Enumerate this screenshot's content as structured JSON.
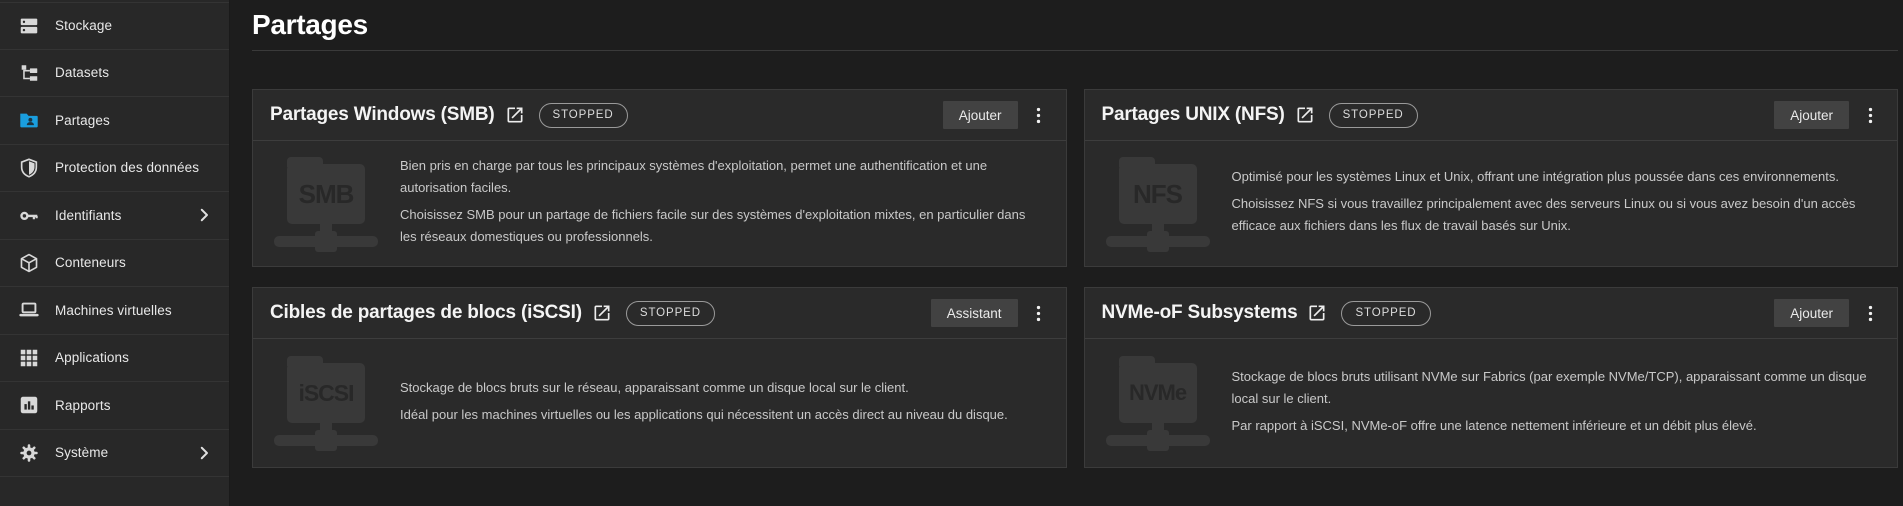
{
  "colors": {
    "accent_blue": "#1a9ede",
    "sidebar_bg": "#282828",
    "main_bg": "#1d1d1d",
    "card_bg": "#2a2a2a",
    "button_bg": "#424242",
    "badge_border": "#9a9a9a"
  },
  "page": {
    "title": "Partages"
  },
  "sidebar": {
    "items": [
      {
        "label": "Stockage",
        "icon": "storage-icon",
        "active": false,
        "chevron": false
      },
      {
        "label": "Datasets",
        "icon": "datasets-icon",
        "active": false,
        "chevron": false
      },
      {
        "label": "Partages",
        "icon": "shares-folder-icon",
        "active": true,
        "chevron": false
      },
      {
        "label": "Protection des données",
        "icon": "shield-icon",
        "active": false,
        "chevron": false
      },
      {
        "label": "Identifiants",
        "icon": "key-icon",
        "active": false,
        "chevron": true
      },
      {
        "label": "Conteneurs",
        "icon": "cube-icon",
        "active": false,
        "chevron": false
      },
      {
        "label": "Machines virtuelles",
        "icon": "laptop-icon",
        "active": false,
        "chevron": false
      },
      {
        "label": "Applications",
        "icon": "apps-grid-icon",
        "active": false,
        "chevron": false
      },
      {
        "label": "Rapports",
        "icon": "bar-chart-icon",
        "active": false,
        "chevron": false
      },
      {
        "label": "Système",
        "icon": "gear-icon",
        "active": false,
        "chevron": true
      }
    ]
  },
  "cards": [
    {
      "title": "Partages Windows (SMB)",
      "status": "STOPPED",
      "action": "Ajouter",
      "icon_label": "SMB",
      "paragraphs": [
        "Bien pris en charge par tous les principaux systèmes d'exploitation, permet une authentification et une autorisation faciles.",
        "Choisissez SMB pour un partage de fichiers facile sur des systèmes d'exploitation mixtes, en particulier dans les réseaux domestiques ou professionnels."
      ]
    },
    {
      "title": "Partages UNIX (NFS)",
      "status": "STOPPED",
      "action": "Ajouter",
      "icon_label": "NFS",
      "paragraphs": [
        "Optimisé pour les systèmes Linux et Unix, offrant une intégration plus poussée dans ces environnements.",
        "Choisissez NFS si vous travaillez principalement avec des serveurs Linux ou si vous avez besoin d'un accès efficace aux fichiers dans les flux de travail basés sur Unix."
      ]
    },
    {
      "title": "Cibles de partages de blocs (iSCSI)",
      "status": "STOPPED",
      "action": "Assistant",
      "icon_label": "iSCSI",
      "paragraphs": [
        "Stockage de blocs bruts sur le réseau, apparaissant comme un disque local sur le client.",
        "Idéal pour les machines virtuelles ou les applications qui nécessitent un accès direct au niveau du disque."
      ]
    },
    {
      "title": "NVMe-oF Subsystems",
      "status": "STOPPED",
      "action": "Ajouter",
      "icon_label": "NVMe",
      "paragraphs": [
        "Stockage de blocs bruts utilisant NVMe sur Fabrics (par exemple NVMe/TCP), apparaissant comme un disque local sur le client.",
        "Par rapport à iSCSI, NVMe-oF offre une latence nettement inférieure et un débit plus élevé."
      ]
    }
  ]
}
